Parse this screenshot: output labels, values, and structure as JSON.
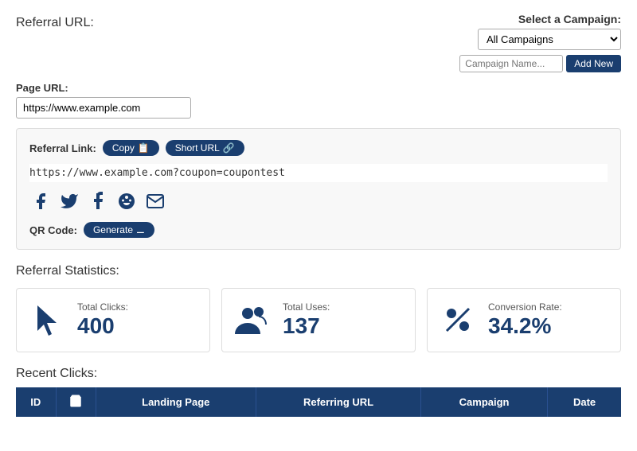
{
  "page": {
    "referral_url_title": "Referral URL:"
  },
  "campaign": {
    "label": "Select a Campaign:",
    "select_options": [
      "All Campaigns"
    ],
    "select_value": "All Campaigns",
    "name_placeholder": "Campaign Name...",
    "add_new_label": "Add New"
  },
  "page_url": {
    "label": "Page URL:",
    "value": "https://www.example.com"
  },
  "referral_link": {
    "label": "Referral Link:",
    "copy_label": "Copy",
    "short_url_label": "Short URL",
    "url_display": "https://www.example.com?coupon=coupontest",
    "qr_label": "QR Code:",
    "generate_label": "Generate"
  },
  "stats": {
    "title": "Referral Statistics:",
    "cards": [
      {
        "label": "Total Clicks:",
        "value": "400",
        "icon": "cursor"
      },
      {
        "label": "Total Uses:",
        "value": "137",
        "icon": "users"
      },
      {
        "label": "Conversion Rate:",
        "value": "34.2%",
        "icon": "percent"
      }
    ]
  },
  "recent_clicks": {
    "title": "Recent Clicks:",
    "columns": [
      "ID",
      "",
      "Landing Page",
      "Referring URL",
      "Campaign",
      "Date"
    ]
  }
}
